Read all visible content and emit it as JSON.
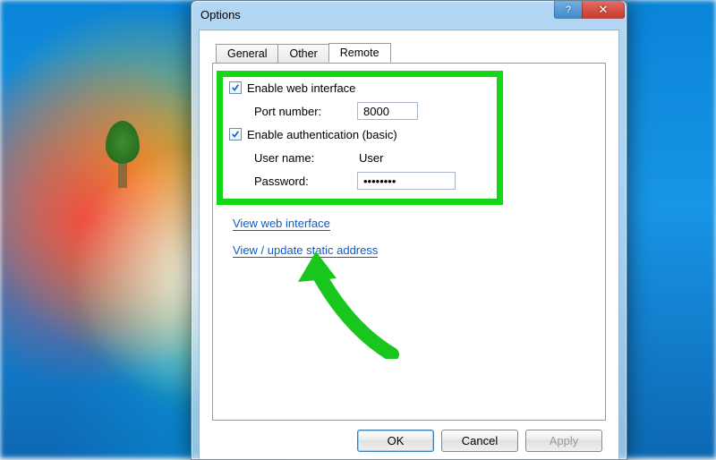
{
  "window": {
    "title": "Options"
  },
  "tabs": {
    "general": "General",
    "other": "Other",
    "remote": "Remote"
  },
  "remote": {
    "enable_web_label": "Enable web interface",
    "port_label": "Port number:",
    "port_value": "8000",
    "enable_auth_label": "Enable authentication (basic)",
    "username_label": "User name:",
    "username_value": "User",
    "password_label": "Password:",
    "password_value": "••••••••",
    "link_view": "View web interface",
    "link_static": "View / update static address"
  },
  "buttons": {
    "ok": "OK",
    "cancel": "Cancel",
    "apply": "Apply"
  },
  "titlebar": {
    "help_glyph": "?",
    "close_glyph": "✕"
  },
  "accent": {
    "highlight": "#14d717",
    "link": "#0a5ccd"
  }
}
